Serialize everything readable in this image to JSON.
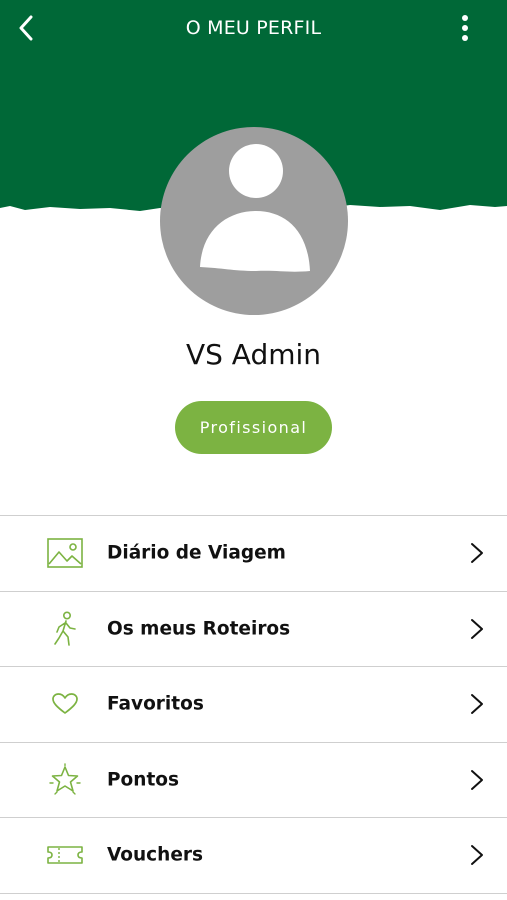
{
  "header": {
    "title": "O MEU PERFIL",
    "back_icon": "chevron-left-icon",
    "menu_icon": "more-vertical-icon",
    "color": "#006837"
  },
  "profile": {
    "avatar_icon": "user-avatar-placeholder",
    "name": "VS Admin",
    "role": "Profissional",
    "role_color": "#7cb342"
  },
  "menu": {
    "icon_color": "#7cb342",
    "items": [
      {
        "label": "Diário de Viagem",
        "icon": "image-icon"
      },
      {
        "label": "Os meus Roteiros",
        "icon": "walking-person-icon"
      },
      {
        "label": "Favoritos",
        "icon": "heart-icon"
      },
      {
        "label": "Pontos",
        "icon": "star-icon"
      },
      {
        "label": "Vouchers",
        "icon": "ticket-icon"
      }
    ]
  }
}
